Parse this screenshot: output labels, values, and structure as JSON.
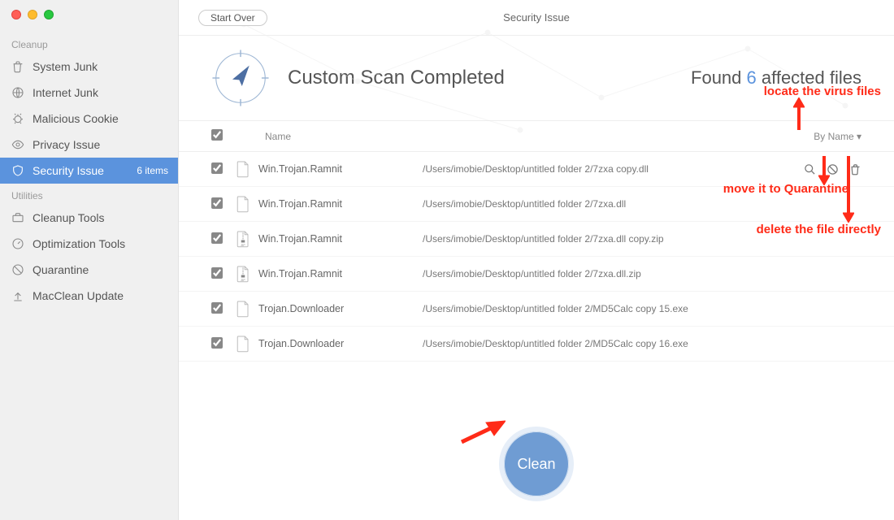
{
  "window": {
    "title": "Security Issue"
  },
  "toolbar": {
    "start_over": "Start Over"
  },
  "sidebar": {
    "cleanup_label": "Cleanup",
    "utilities_label": "Utilities",
    "items": {
      "system_junk": "System Junk",
      "internet_junk": "Internet Junk",
      "malicious_cookie": "Malicious Cookie",
      "privacy_issue": "Privacy Issue",
      "security_issue": "Security Issue",
      "security_badge": "6 items",
      "cleanup_tools": "Cleanup Tools",
      "optimization_tools": "Optimization Tools",
      "quarantine": "Quarantine",
      "macclean_update": "MacClean Update"
    }
  },
  "scan": {
    "title": "Custom Scan Completed",
    "found_prefix": "Found ",
    "found_count": "6",
    "found_suffix": " affected files"
  },
  "table": {
    "name_header": "Name",
    "sort_label": "By Name ▾",
    "rows": [
      {
        "name": "Win.Trojan.Ramnit",
        "path": "/Users/imobie/Desktop/untitled folder 2/7zxa copy.dll",
        "zip": false,
        "actions": true
      },
      {
        "name": "Win.Trojan.Ramnit",
        "path": "/Users/imobie/Desktop/untitled folder 2/7zxa.dll",
        "zip": false,
        "actions": false
      },
      {
        "name": "Win.Trojan.Ramnit",
        "path": "/Users/imobie/Desktop/untitled folder 2/7zxa.dll copy.zip",
        "zip": true,
        "actions": false
      },
      {
        "name": "Win.Trojan.Ramnit",
        "path": "/Users/imobie/Desktop/untitled folder 2/7zxa.dll.zip",
        "zip": true,
        "actions": false
      },
      {
        "name": "Trojan.Downloader",
        "path": "/Users/imobie/Desktop/untitled folder 2/MD5Calc copy 15.exe",
        "zip": false,
        "actions": false
      },
      {
        "name": "Trojan.Downloader",
        "path": "/Users/imobie/Desktop/untitled folder 2/MD5Calc copy 16.exe",
        "zip": false,
        "actions": false
      }
    ]
  },
  "clean_label": "Clean",
  "annotations": {
    "locate": "locate the virus files",
    "quarantine": "move it to Quarantine",
    "delete": "delete the file directly"
  }
}
